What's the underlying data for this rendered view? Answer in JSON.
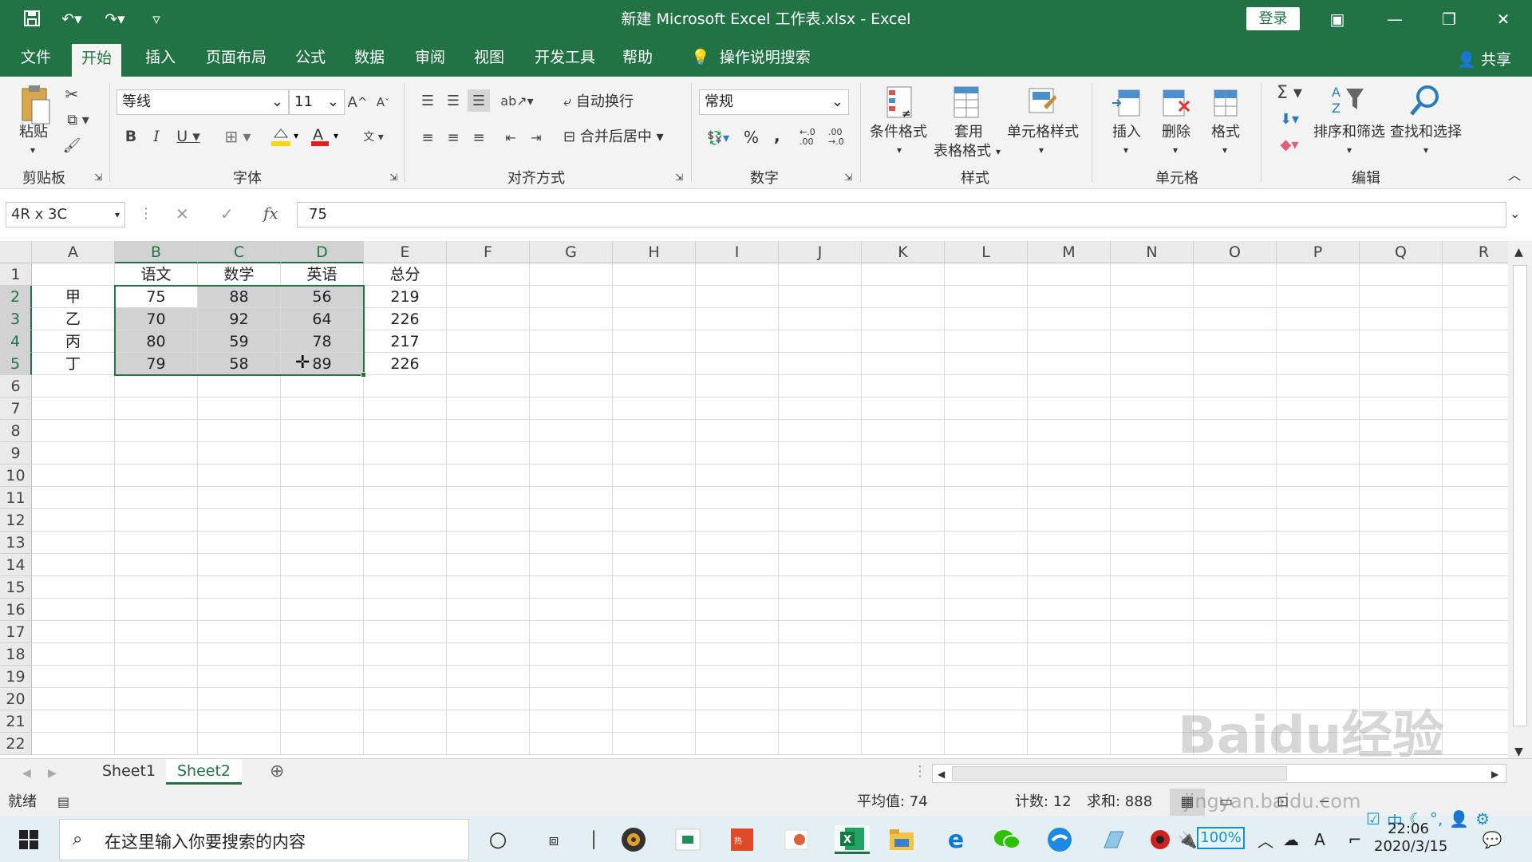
{
  "window": {
    "title": "新建 Microsoft Excel 工作表.xlsx  -  Excel",
    "login_label": "登录"
  },
  "tabs": [
    "文件",
    "开始",
    "插入",
    "页面布局",
    "公式",
    "数据",
    "审阅",
    "视图",
    "开发工具",
    "帮助"
  ],
  "active_tab": "开始",
  "tell_me": "操作说明搜索",
  "share_label": "共享",
  "ribbon": {
    "clipboard": {
      "paste": "粘贴",
      "group": "剪贴板"
    },
    "font": {
      "name": "等线",
      "size": "11",
      "group": "字体"
    },
    "alignment": {
      "wrap": "自动换行",
      "merge": "合并后居中",
      "group": "对齐方式"
    },
    "number": {
      "format": "常规",
      "group": "数字",
      "percent": "%",
      "comma": ",",
      "inc_decimal": "←.0 .00",
      "dec_decimal": ".00 →.0"
    },
    "styles": {
      "conditional": "条件格式",
      "table_line1": "套用",
      "table_line2": "表格格式",
      "cell_styles": "单元格样式",
      "group": "样式"
    },
    "cells": {
      "insert": "插入",
      "delete": "删除",
      "format": "格式",
      "group": "单元格"
    },
    "editing": {
      "sort_filter": "排序和筛选",
      "find_select": "查找和选择",
      "group": "编辑"
    }
  },
  "formula_bar": {
    "name_box": "4R x 3C",
    "fx_label": "fx",
    "value": "75"
  },
  "columns": [
    "A",
    "B",
    "C",
    "D",
    "E",
    "F",
    "G",
    "H",
    "I",
    "J",
    "K",
    "L",
    "M",
    "N",
    "O",
    "P",
    "Q",
    "R"
  ],
  "rows": [
    "1",
    "2",
    "3",
    "4",
    "5",
    "6",
    "7",
    "8",
    "9",
    "10",
    "11",
    "12",
    "13",
    "14",
    "15",
    "16",
    "17",
    "18",
    "19",
    "20",
    "21",
    "22"
  ],
  "cells": [
    [
      "",
      "语文",
      "数学",
      "英语",
      "总分"
    ],
    [
      "甲",
      "75",
      "88",
      "56",
      "219"
    ],
    [
      "乙",
      "70",
      "92",
      "64",
      "226"
    ],
    [
      "丙",
      "80",
      "59",
      "78",
      "217"
    ],
    [
      "丁",
      "79",
      "58",
      "89",
      "226"
    ]
  ],
  "sheets": [
    "Sheet1",
    "Sheet2"
  ],
  "active_sheet": "Sheet2",
  "status": {
    "ready": "就绪",
    "average": "平均值: 74",
    "count": "计数: 12",
    "sum": "求和: 888"
  },
  "taskbar": {
    "search_placeholder": "在这里输入你要搜索的内容",
    "battery": "100%",
    "ime": "中",
    "time": "22:06",
    "date": "2020/3/15"
  },
  "watermark": "Baidu经验 jingyan.baidu.com",
  "colors": {
    "excel_green": "#217346",
    "selection_fill": "#d2d2d2"
  }
}
